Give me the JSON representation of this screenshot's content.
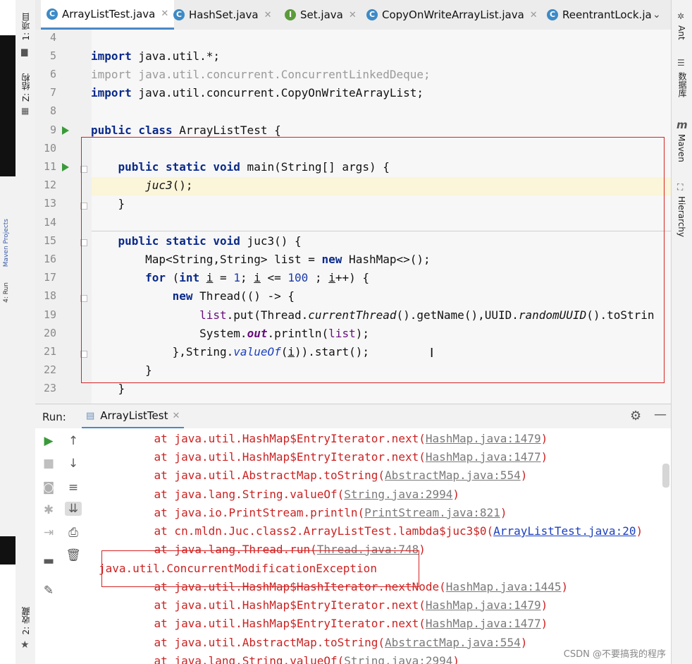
{
  "tabs": [
    {
      "label": "ArrayListTest.java",
      "icon": "class-icon",
      "active": true
    },
    {
      "label": "HashSet.java",
      "icon": "class-icon",
      "active": false
    },
    {
      "label": "Set.java",
      "icon": "interface-icon",
      "active": false
    },
    {
      "label": "CopyOnWriteArrayList.java",
      "icon": "class-icon",
      "active": false
    },
    {
      "label": "ReentrantLock.ja",
      "icon": "class-icon",
      "active": false
    }
  ],
  "left_strip": {
    "project": "1: 项目",
    "structure": "Z: 结构",
    "favorites": "2: 收藏"
  },
  "outer_left": {
    "maven": "Maven Projects",
    "run": "4: Run"
  },
  "right_strip": {
    "ant": "Ant",
    "database": "数据库",
    "maven": "Maven",
    "hierarchy": "Hierarchy"
  },
  "editor": {
    "line_numbers": [
      "4",
      "5",
      "6",
      "7",
      "8",
      "9",
      "10",
      "11",
      "12",
      "13",
      "14",
      "15",
      "16",
      "17",
      "18",
      "19",
      "20",
      "21",
      "22",
      "23"
    ]
  },
  "run_panel": {
    "title": "Run:",
    "tab_label": "ArrayListTest"
  },
  "console": {
    "lines": [
      {
        "text": "    at java.util.HashMap$EntryIterator.next(",
        "link": "HashMap.java:1479",
        "tail": ")"
      },
      {
        "text": "    at java.util.HashMap$EntryIterator.next(",
        "link": "HashMap.java:1477",
        "tail": ")"
      },
      {
        "text": "    at java.util.AbstractMap.toString(",
        "link": "AbstractMap.java:554",
        "tail": ")"
      },
      {
        "text": "    at java.lang.String.valueOf(",
        "link": "String.java:2994",
        "tail": ")"
      },
      {
        "text": "    at java.io.PrintStream.println(",
        "link": "PrintStream.java:821",
        "tail": ")"
      },
      {
        "text": "    at cn.mldn.Juc.class2.ArrayListTest.lambda$juc3$0(",
        "link": "ArrayListTest.java:20",
        "tail": ")"
      },
      {
        "text": "    at java.lang.Thread.run(",
        "link": "Thread.java:748",
        "tail": ")"
      },
      {
        "text": "java.util.ConcurrentModificationException",
        "link": "",
        "tail": ""
      },
      {
        "text": "    at java.util.HashMap$HashIterator.nextNode(",
        "link": "HashMap.java:1445",
        "tail": ")"
      },
      {
        "text": "    at java.util.HashMap$EntryIterator.next(",
        "link": "HashMap.java:1479",
        "tail": ")"
      },
      {
        "text": "    at java.util.HashMap$EntryIterator.next(",
        "link": "HashMap.java:1477",
        "tail": ")"
      },
      {
        "text": "    at java.util.AbstractMap.toString(",
        "link": "AbstractMap.java:554",
        "tail": ")"
      },
      {
        "text": "    at java.lang.String.valueOf(",
        "link": "String.java:2994",
        "tail": ")"
      }
    ]
  },
  "watermark": "CSDN @不要搞我的程序",
  "colors": {
    "keyword": "#0a2a8a",
    "error": "#cc2222",
    "accent": "#4a88c7",
    "highlight_box": "#d62222"
  }
}
